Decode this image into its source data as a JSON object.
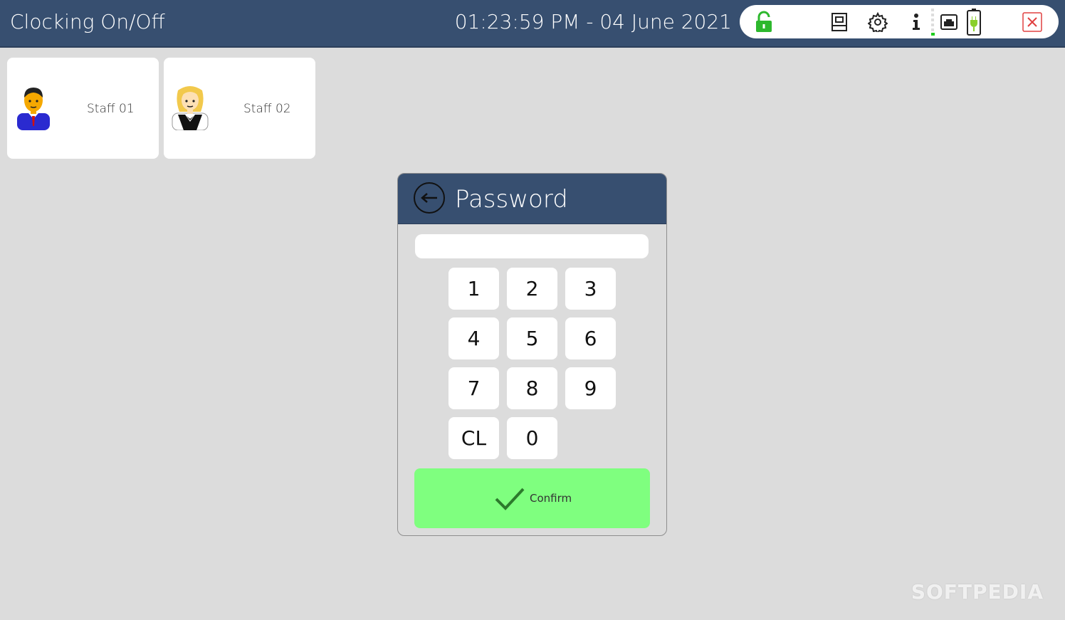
{
  "header": {
    "title": "Clocking On/Off",
    "datetime": "01:23:59 PM - 04 June 2021"
  },
  "status_icons": [
    "unlock-icon",
    "register-icon",
    "gear-icon",
    "info-icon",
    "signal-icon",
    "network-icon",
    "battery-icon",
    "close-icon"
  ],
  "colors": {
    "header_bg": "#374f70",
    "background": "#dcdcdc",
    "confirm_bg": "#7fff7f",
    "lock_green": "#2db82d",
    "close_red": "#e04040"
  },
  "staff": [
    {
      "name": "Staff 01",
      "avatar": "man-avatar-icon"
    },
    {
      "name": "Staff 02",
      "avatar": "woman-avatar-icon"
    }
  ],
  "dialog": {
    "title": "Password",
    "password_value": "",
    "keys": [
      "1",
      "2",
      "3",
      "4",
      "5",
      "6",
      "7",
      "8",
      "9",
      "CL",
      "0"
    ],
    "confirm_label": "Confirm"
  },
  "watermark": "SOFTPEDIA"
}
